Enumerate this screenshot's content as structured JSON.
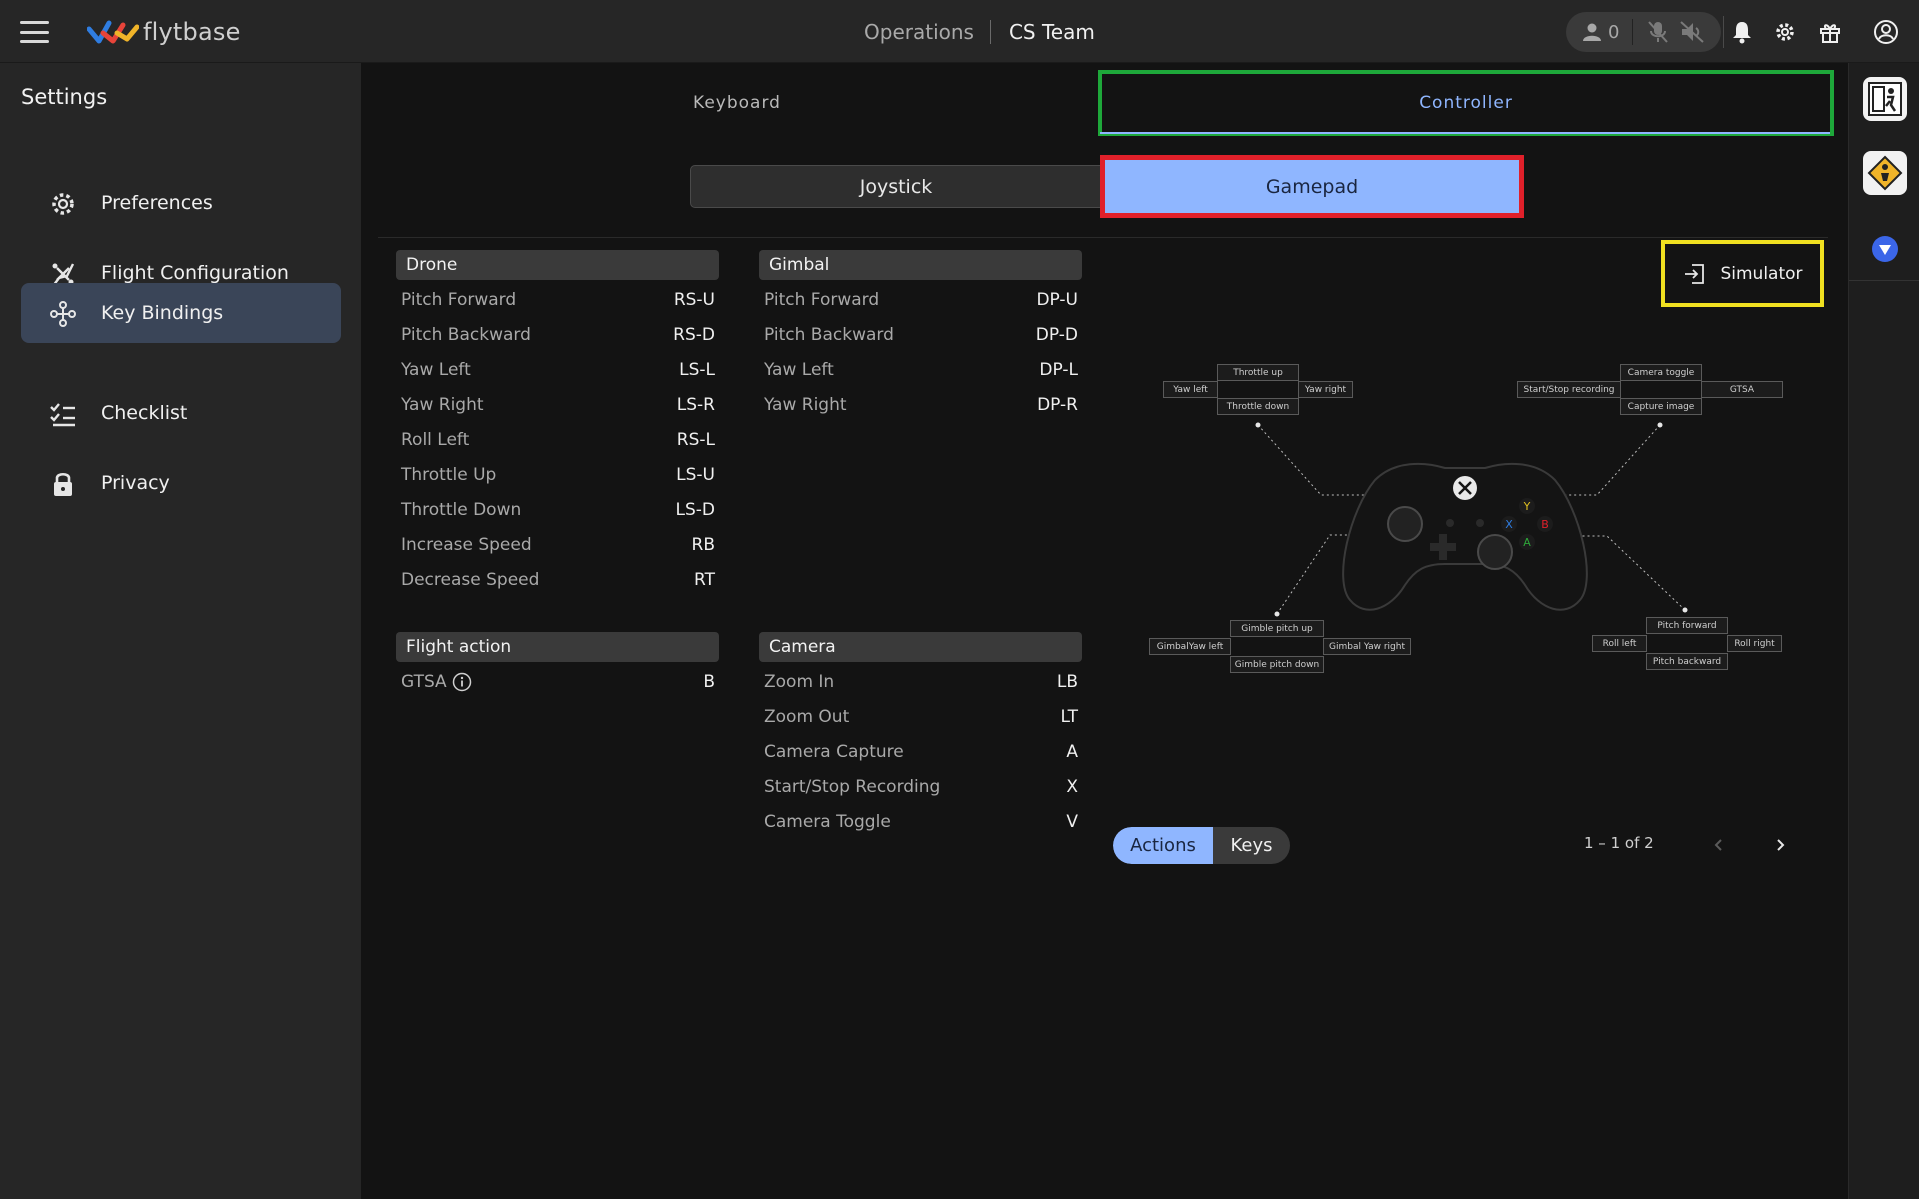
{
  "app": {
    "logo_text": "flytbase"
  },
  "header": {
    "nav_operations": "Operations",
    "nav_team": "CS Team",
    "user_count": "0"
  },
  "sidebar": {
    "title": "Settings",
    "items": [
      {
        "label": "Preferences",
        "icon": "gear-icon"
      },
      {
        "label": "Flight Configuration",
        "icon": "drone-icon"
      },
      {
        "label": "Key Bindings",
        "icon": "gamepad-icon"
      },
      {
        "label": "Checklist",
        "icon": "checklist-icon"
      },
      {
        "label": "Privacy",
        "icon": "lock-icon"
      }
    ]
  },
  "tabs": {
    "keyboard": "Keyboard",
    "controller": "Controller"
  },
  "segments": {
    "joystick": "Joystick",
    "gamepad": "Gamepad"
  },
  "sections": {
    "drone": {
      "title": "Drone",
      "rows": [
        {
          "label": "Pitch Forward",
          "key": "RS-U"
        },
        {
          "label": "Pitch Backward",
          "key": "RS-D"
        },
        {
          "label": "Yaw Left",
          "key": "LS-L"
        },
        {
          "label": "Yaw Right",
          "key": "LS-R"
        },
        {
          "label": "Roll Left",
          "key": "RS-L"
        },
        {
          "label": "Throttle Up",
          "key": "LS-U"
        },
        {
          "label": "Throttle Down",
          "key": "LS-D"
        },
        {
          "label": "Increase Speed",
          "key": "RB"
        },
        {
          "label": "Decrease Speed",
          "key": "RT"
        }
      ]
    },
    "gimbal": {
      "title": "Gimbal",
      "rows": [
        {
          "label": "Pitch Forward",
          "key": "DP-U"
        },
        {
          "label": "Pitch Backward",
          "key": "DP-D"
        },
        {
          "label": "Yaw Left",
          "key": "DP-L"
        },
        {
          "label": "Yaw Right",
          "key": "DP-R"
        }
      ]
    },
    "flight_action": {
      "title": "Flight action",
      "rows": [
        {
          "label": "GTSA",
          "key": "B"
        }
      ]
    },
    "camera": {
      "title": "Camera",
      "rows": [
        {
          "label": "Zoom In",
          "key": "LB"
        },
        {
          "label": "Zoom Out",
          "key": "LT"
        },
        {
          "label": "Camera Capture",
          "key": "A"
        },
        {
          "label": "Start/Stop Recording",
          "key": "X"
        },
        {
          "label": "Camera Toggle",
          "key": "V"
        }
      ]
    }
  },
  "simulator": {
    "label": "Simulator"
  },
  "diagram": {
    "left_stick": {
      "up": "Throttle up",
      "down": "Throttle down",
      "left": "Yaw left",
      "right": "Yaw right"
    },
    "buttons": {
      "up": "Camera toggle",
      "down": "Capture image",
      "left": "Start/Stop recording",
      "right": "GTSA"
    },
    "dpad": {
      "up": "Gimble pitch up",
      "down": "Gimble pitch down",
      "left": "GimbalYaw left",
      "right": "Gimbal Yaw right"
    },
    "right_stick": {
      "up": "Pitch forward",
      "down": "Pitch backward",
      "left": "Roll left",
      "right": "Roll right"
    }
  },
  "view_toggle": {
    "actions": "Actions",
    "keys": "Keys"
  },
  "pagination": {
    "text": "1 – 1 of 2"
  },
  "colors": {
    "accent": "#8fb6ff",
    "green_outline": "#1ea83a",
    "red_outline": "#e0202a",
    "yellow_outline": "#f0e020"
  }
}
